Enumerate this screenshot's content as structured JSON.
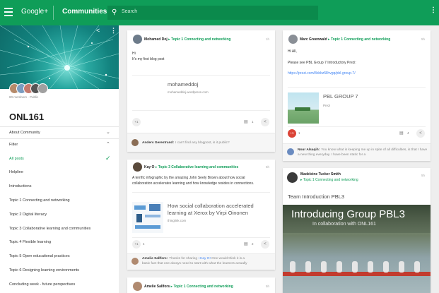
{
  "topbar": {
    "brand": "Google+",
    "section": "Communities",
    "search_placeholder": "Search"
  },
  "sidebar": {
    "members": "80 members · Public",
    "title": "ONL161",
    "about": "About Community",
    "filter": "Filter",
    "items": [
      "All posts",
      "Helpline",
      "Introductions",
      "Topic 1 Connecting and networking",
      "Topic 2 Digital literacy",
      "Topic 3 Collaborative learning and communities",
      "Topic 4 Flexible learning",
      "Topic 5 Open educational practices",
      "Topic 6 Designing learning environments",
      "Concluding week - future perspectives"
    ]
  },
  "posts": {
    "p1": {
      "author": "Mohamed Doj",
      "topic": "Topic 1 Connecting and networking",
      "time": "1h",
      "body1": "Hi",
      "body2": "It's my first blog post",
      "link_title": "mohameddoj",
      "link_site": "mohameddoj.wordpress.com",
      "plus": "+1",
      "comments": "1",
      "commenter": "Anders Gerestrand:",
      "comment": "I can't find any blogpost, is it public?"
    },
    "p2": {
      "author": "Marc Greenwald",
      "topic": "Topic 1 Connecting and networking",
      "time": "5h",
      "body1": "Hi All,",
      "body2": "Please see PBL Group 7 Introductory Prezi:",
      "url": "https://prezi.com/8dcbz5llhvgq/pbl-group-7/",
      "link_title": "PBL GROUP 7",
      "link_site": "Prezi",
      "plus": "+1",
      "plus_count": "1",
      "comments": "4",
      "commenter": "Nour Alsaqih:",
      "comment": "You know what is keeping me up in spite of all difficulties, is that I have a new thing everyday. I have been static for a"
    },
    "p3": {
      "author": "Kay O",
      "topic": "Topic 3 Collaborative learning and communities",
      "time": "5h",
      "body1": "A terrific infographic by the amazing John Seely Brown about how social",
      "body2": "collaboration accelerates learning and how knowledge resides in connections.",
      "link_title1": "How social collaboration accelerated",
      "link_title2": "learning at Xerox by Virpi Oinonen",
      "link_site": "thinglink.com",
      "plus": "+1",
      "plus_count": "4",
      "comments": "2",
      "commenter": "Amelie Sallfors:",
      "comment1": "Thanks for sharing",
      "mention": "+Kay O!",
      "comment2": "One would think it is a",
      "comment3": "basic fact that one always need to start with what the learners actually"
    },
    "p4": {
      "author": "Madeleine Tucker Smith",
      "topic": "Topic 1 Connecting and networking",
      "time": "5h",
      "title": "Team Introduction PBL3",
      "img_title": "Introducing Group PBL3",
      "img_sub": "In collaboration with ONL161"
    },
    "p5": {
      "author": "Amelie Sallfors",
      "topic": "Topic 1 Connecting and networking",
      "time": "5h"
    }
  }
}
